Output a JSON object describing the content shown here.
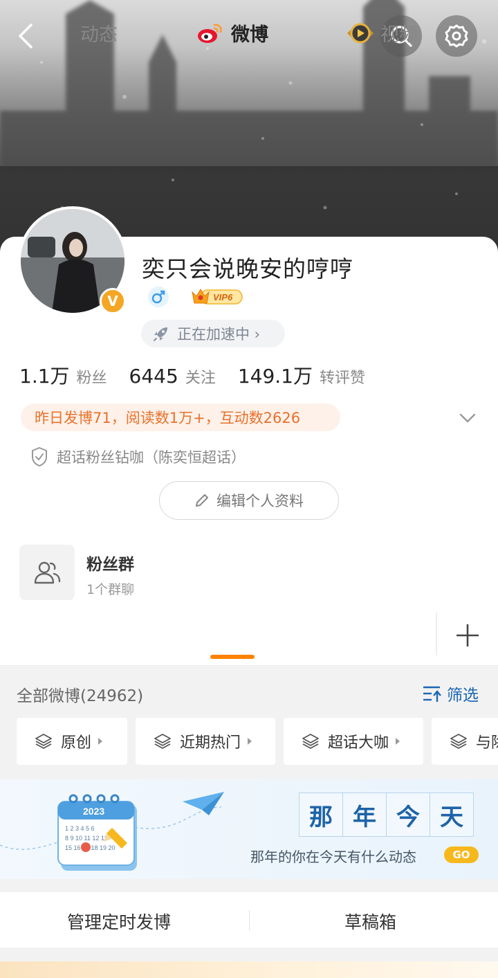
{
  "profile": {
    "nickname": "奕只会说晚安的哼哼",
    "verified_badge": "V",
    "vip_label": "VIP6",
    "boost_label": "正在加速中 ›"
  },
  "stats": [
    {
      "value": "1.1万",
      "label": "粉丝"
    },
    {
      "value": "6445",
      "label": "关注"
    },
    {
      "value": "149.1万",
      "label": "转评赞"
    }
  ],
  "activity": "昨日发博71，阅读数1万+，互动数2626",
  "supertopic": "超话粉丝钻咖（陈奕恒超话）",
  "edit_profile_label": "编辑个人资料",
  "fan_group": {
    "title": "粉丝群",
    "subtitle": "1个群聊"
  },
  "tabs": [
    {
      "label": "动态"
    },
    {
      "label": "微博"
    },
    {
      "label": "视频"
    }
  ],
  "filter": {
    "all_label": "全部微博(24962)",
    "filter_label": "筛选",
    "chips": [
      "原创",
      "近期热门",
      "超话大咖",
      "与除"
    ]
  },
  "memory": {
    "title_chars": [
      "那",
      "年",
      "今",
      "天"
    ],
    "subtitle": "那年的你在今天有什么动态",
    "go_label": "GO",
    "calendar_year": "2023"
  },
  "bottom": {
    "scheduled_label": "管理定时发博",
    "drafts_label": "草稿箱"
  },
  "colors": {
    "accent_orange": "#ff8200",
    "link_blue": "#1a66b4",
    "activity_text": "#e9712b",
    "verified_orange": "#f5a623"
  },
  "icons": {
    "back": "chevron-left-icon",
    "search": "search-icon",
    "settings": "gear-icon",
    "gender": "male-icon",
    "rocket": "rocket-icon",
    "shield": "shield-check-icon",
    "pencil": "pencil-icon",
    "group": "group-icon",
    "weibo": "weibo-logo-icon",
    "video": "video-play-icon",
    "plus": "plus-icon",
    "filter": "filter-icon",
    "layers": "layers-icon"
  }
}
